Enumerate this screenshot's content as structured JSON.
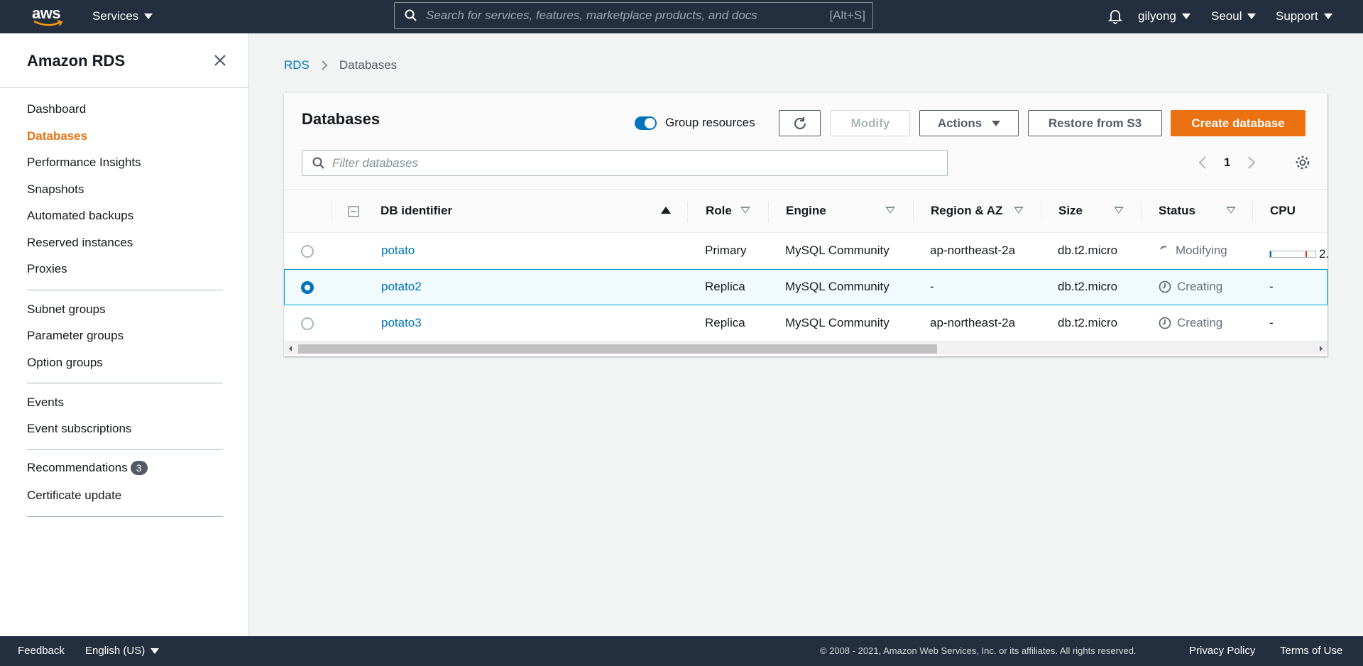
{
  "topbar": {
    "logo_text": "aws",
    "services_label": "Services",
    "search_placeholder": "Search for services, features, marketplace products, and docs",
    "search_shortcut": "[Alt+S]",
    "user_label": "gilyong",
    "region_label": "Seoul",
    "support_label": "Support"
  },
  "sidebar": {
    "title": "Amazon RDS",
    "items": [
      {
        "label": "Dashboard"
      },
      {
        "label": "Databases"
      },
      {
        "label": "Performance Insights"
      },
      {
        "label": "Snapshots"
      },
      {
        "label": "Automated backups"
      },
      {
        "label": "Reserved instances"
      },
      {
        "label": "Proxies"
      },
      {
        "label": "Subnet groups"
      },
      {
        "label": "Parameter groups"
      },
      {
        "label": "Option groups"
      },
      {
        "label": "Events"
      },
      {
        "label": "Event subscriptions"
      },
      {
        "label": "Recommendations"
      },
      {
        "label": "Certificate update"
      }
    ],
    "recommendations_count": "3",
    "active_item": "Databases"
  },
  "breadcrumb": {
    "root": "RDS",
    "current": "Databases"
  },
  "panel": {
    "title": "Databases",
    "group_resources_label": "Group resources",
    "modify_label": "Modify",
    "actions_label": "Actions",
    "restore_label": "Restore from S3",
    "create_label": "Create database",
    "filter_placeholder": "Filter databases",
    "page_number": "1"
  },
  "table": {
    "headers": {
      "db_identifier": "DB identifier",
      "role": "Role",
      "engine": "Engine",
      "region_az": "Region & AZ",
      "size": "Size",
      "status": "Status",
      "cpu": "CPU"
    },
    "rows": [
      {
        "id": "potato",
        "role": "Primary",
        "engine": "MySQL Community",
        "region": "ap-northeast-2a",
        "size": "db.t2.micro",
        "status": "Modifying",
        "cpu": "2.",
        "selected": false
      },
      {
        "id": "potato2",
        "role": "Replica",
        "engine": "MySQL Community",
        "region": "-",
        "size": "db.t2.micro",
        "status": "Creating",
        "cpu": "-",
        "selected": true
      },
      {
        "id": "potato3",
        "role": "Replica",
        "engine": "MySQL Community",
        "region": "ap-northeast-2a",
        "size": "db.t2.micro",
        "status": "Creating",
        "cpu": "-",
        "selected": false
      }
    ]
  },
  "footer": {
    "feedback": "Feedback",
    "language": "English (US)",
    "copyright": "© 2008 - 2021, Amazon Web Services, Inc. or its affiliates. All rights reserved.",
    "privacy": "Privacy Policy",
    "terms": "Terms of Use"
  },
  "colors": {
    "accent": "#ec7211",
    "link": "#0073bb",
    "topbar": "#232f3e"
  },
  "icons": [
    "search-icon",
    "bell-icon",
    "close-icon",
    "chevron-right-icon",
    "refresh-icon",
    "caret-down-icon",
    "chevron-left-icon",
    "gear-icon",
    "collapse-icon",
    "clock-icon",
    "spinner-icon"
  ]
}
